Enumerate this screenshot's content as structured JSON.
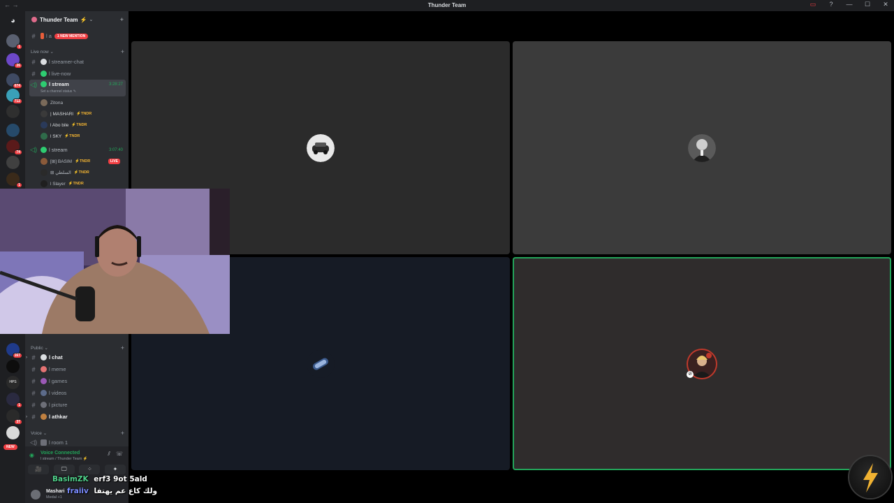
{
  "window": {
    "title": "Thunder Team",
    "nav_glyph": "← →",
    "controls": {
      "cast": "▭",
      "help": "?",
      "minimize": "—",
      "maximize": "☐",
      "close": "✕"
    }
  },
  "servers": [
    {
      "badge": "1",
      "color": "#5a6070"
    },
    {
      "badge": "26",
      "color": "#6d48c8"
    },
    {
      "badge": "674",
      "color": "#3f4a63"
    },
    {
      "badge": "712",
      "color": "#3aa0b8"
    },
    {
      "badge": "",
      "color": "#2f2f2f"
    },
    {
      "badge": "",
      "color": "#264a6a"
    },
    {
      "badge": "74",
      "color": "#5a1a1a"
    },
    {
      "badge": "",
      "color": "#404040"
    },
    {
      "badge": "1",
      "color": "#3a2a1a"
    },
    {
      "badge": "",
      "color": "#3a2530"
    }
  ],
  "servers_lower": [
    {
      "badge": "167",
      "color": "#1f3a8a"
    },
    {
      "badge": "",
      "color": "#0d0d0d"
    },
    {
      "badge": "",
      "color": "#2a2a2a",
      "text": "HPS"
    },
    {
      "badge": "1",
      "color": "#2a2a40"
    },
    {
      "badge": "37",
      "color": "#2a2a2a"
    },
    {
      "badge": "",
      "color": "#d9d9d9"
    }
  ],
  "new_pill": "NEW",
  "guild": {
    "name": "Thunder Team",
    "bolt": "⚡",
    "chevron": "⌄",
    "invite_icon": "+"
  },
  "top_channel": {
    "prefix": "l a",
    "mention": "1 NEW MENTION"
  },
  "categories": {
    "live_now": "Live now ⌄",
    "public": "Public ⌄",
    "voice": "Voice ⌄",
    "plus": "+"
  },
  "live_channels": [
    {
      "label": "l streamer-chat"
    },
    {
      "label": "l live-now"
    },
    {
      "label": "l stream",
      "timer": "3:28:27",
      "status": "Set a channel status ✎"
    }
  ],
  "stream1_users": [
    {
      "name": "Zitona",
      "tag": ""
    },
    {
      "name": "| MASHARI",
      "tag": "⚡TNDR"
    },
    {
      "name": "l Abo bile",
      "tag": "⚡TNDR"
    },
    {
      "name": "l SKY",
      "tag": "⚡TNDR"
    }
  ],
  "stream2": {
    "label": "l stream",
    "timer": "3:07:40"
  },
  "stream2_users": [
    {
      "name": "[⊞] BASIM",
      "tag": "⚡TNDR",
      "live": "LIVE"
    },
    {
      "name": "⊞ السلطي",
      "tag": "⚡TNDR"
    },
    {
      "name": "l Slayer",
      "tag": "⚡TNDR"
    }
  ],
  "public_channels": [
    {
      "label": "l chat",
      "unread": true
    },
    {
      "label": "l meme",
      "unread": false
    },
    {
      "label": "l games",
      "unread": false
    },
    {
      "label": "l videos",
      "unread": false
    },
    {
      "label": "l picture",
      "unread": false
    },
    {
      "label": "l athkar",
      "unread": true
    }
  ],
  "voice_channel": "l room 1",
  "voice_status": {
    "title": "Voice Connected",
    "subtitle": "l stream / Thunder Team ⚡",
    "buttons": [
      "🎥",
      "🖵",
      "⁘",
      "✦"
    ],
    "icons": {
      "signal": "◉",
      "noise": "⫽",
      "disconnect": "☏"
    }
  },
  "user_panel": {
    "name": "Mashari",
    "status": "Medal +1"
  },
  "tiles": [
    {
      "id": "top-left",
      "bg": "#2b2b2b"
    },
    {
      "id": "top-right",
      "bg": "#3b3b3b"
    },
    {
      "id": "bottom-left",
      "bg": "#161b25"
    },
    {
      "id": "bottom-right",
      "bg": "#2f2c2c",
      "speaking": true,
      "mic_off": "⊘"
    }
  ],
  "chat_overlay": [
    {
      "user": "BasimZK",
      "message": "erf3 9ot 5ald"
    },
    {
      "user": "fraiiv",
      "message": "ولك كاع عم يهتفا"
    }
  ],
  "corner_badge": "⚡",
  "colors": {
    "accent_green": "#23a55a",
    "mention_red": "#f23f43",
    "tndr_gold": "#f0b232"
  }
}
